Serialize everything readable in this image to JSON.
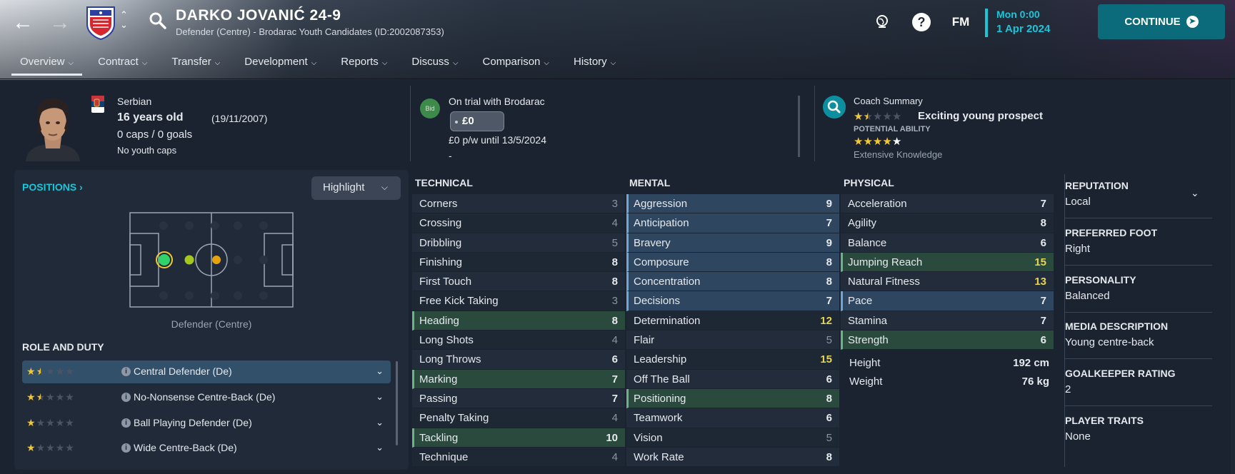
{
  "header": {
    "player_name": "DARKO JOVANIĆ 24-9",
    "subtitle": "Defender (Centre) - Brodarac Youth Candidates (ID:2002087353)",
    "time": "Mon 0:00",
    "date": "1 Apr 2024",
    "fm_logo": "FM",
    "help": "?",
    "continue_label": "CONTINUE",
    "accent": "#19c6d8"
  },
  "tabs": [
    {
      "label": "Overview"
    },
    {
      "label": "Contract"
    },
    {
      "label": "Transfer"
    },
    {
      "label": "Development"
    },
    {
      "label": "Reports"
    },
    {
      "label": "Discuss"
    },
    {
      "label": "Comparison"
    },
    {
      "label": "History"
    }
  ],
  "info": {
    "nationality": "Serbian",
    "age": "16 years old",
    "dob": "(19/11/2007)",
    "caps": "0 caps / 0 goals",
    "youth_caps": "No youth caps",
    "bid_label": "Bid",
    "trial_text": "On trial with Brodarac",
    "fee": "£0",
    "wage": "£0 p/w until 13/5/2024",
    "dash": "-",
    "coach_title": "Coach Summary",
    "coach_verdict": "Exciting young prospect",
    "current_ability_stars": 1.5,
    "potential_label": "POTENTIAL ABILITY",
    "potential_ability_stars": 4,
    "knowledge": "Extensive Knowledge"
  },
  "positions": {
    "title": "POSITIONS",
    "highlight_label": "Highlight",
    "position_label": "Defender (Centre)"
  },
  "roles": {
    "title": "ROLE AND DUTY",
    "items": [
      {
        "label": "Central Defender (De)",
        "stars": 1.5
      },
      {
        "label": "No-Nonsense Centre-Back (De)",
        "stars": 1.5
      },
      {
        "label": "Ball Playing Defender (De)",
        "stars": 1
      },
      {
        "label": "Wide Centre-Back (De)",
        "stars": 1
      }
    ]
  },
  "technical": {
    "title": "TECHNICAL",
    "rows": [
      {
        "name": "Corners",
        "value": "3"
      },
      {
        "name": "Crossing",
        "value": "4"
      },
      {
        "name": "Dribbling",
        "value": "5"
      },
      {
        "name": "Finishing",
        "value": "8"
      },
      {
        "name": "First Touch",
        "value": "8"
      },
      {
        "name": "Free Kick Taking",
        "value": "3"
      },
      {
        "name": "Heading",
        "value": "8"
      },
      {
        "name": "Long Shots",
        "value": "4"
      },
      {
        "name": "Long Throws",
        "value": "6"
      },
      {
        "name": "Marking",
        "value": "7"
      },
      {
        "name": "Passing",
        "value": "7"
      },
      {
        "name": "Penalty Taking",
        "value": "4"
      },
      {
        "name": "Tackling",
        "value": "10"
      },
      {
        "name": "Technique",
        "value": "4"
      }
    ]
  },
  "mental": {
    "title": "MENTAL",
    "rows": [
      {
        "name": "Aggression",
        "value": "9"
      },
      {
        "name": "Anticipation",
        "value": "7"
      },
      {
        "name": "Bravery",
        "value": "9"
      },
      {
        "name": "Composure",
        "value": "8"
      },
      {
        "name": "Concentration",
        "value": "8"
      },
      {
        "name": "Decisions",
        "value": "7"
      },
      {
        "name": "Determination",
        "value": "12"
      },
      {
        "name": "Flair",
        "value": "5"
      },
      {
        "name": "Leadership",
        "value": "15"
      },
      {
        "name": "Off The Ball",
        "value": "6"
      },
      {
        "name": "Positioning",
        "value": "8"
      },
      {
        "name": "Teamwork",
        "value": "6"
      },
      {
        "name": "Vision",
        "value": "5"
      },
      {
        "name": "Work Rate",
        "value": "8"
      }
    ]
  },
  "physical": {
    "title": "PHYSICAL",
    "rows": [
      {
        "name": "Acceleration",
        "value": "7"
      },
      {
        "name": "Agility",
        "value": "8"
      },
      {
        "name": "Balance",
        "value": "6"
      },
      {
        "name": "Jumping Reach",
        "value": "15"
      },
      {
        "name": "Natural Fitness",
        "value": "13"
      },
      {
        "name": "Pace",
        "value": "7"
      },
      {
        "name": "Stamina",
        "value": "7"
      },
      {
        "name": "Strength",
        "value": "6"
      }
    ],
    "height_label": "Height",
    "height": "192 cm",
    "weight_label": "Weight",
    "weight": "76 kg"
  },
  "profile": {
    "reputation_title": "REPUTATION",
    "reputation": "Local",
    "foot_title": "PREFERRED FOOT",
    "foot": "Right",
    "personality_title": "PERSONALITY",
    "personality": "Balanced",
    "media_title": "MEDIA DESCRIPTION",
    "media": "Young centre-back",
    "gk_title": "GOALKEEPER RATING",
    "gk": "2",
    "traits_title": "PLAYER TRAITS",
    "traits": "None"
  }
}
